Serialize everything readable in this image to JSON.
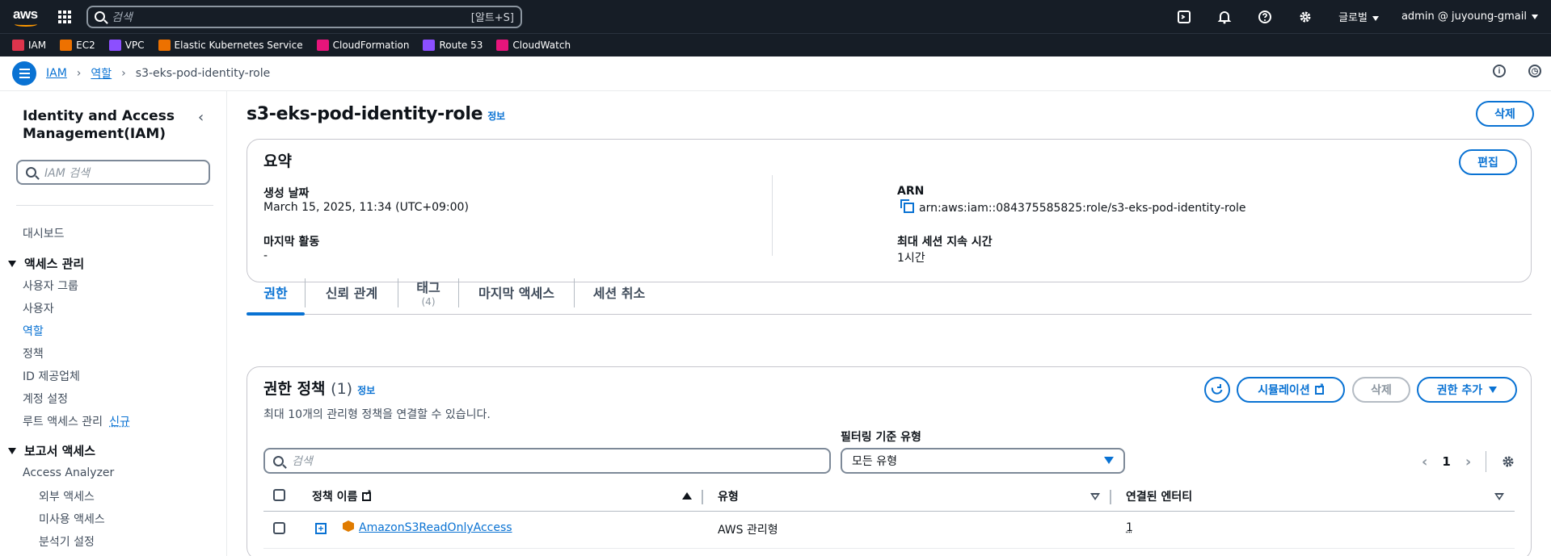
{
  "topnav": {
    "search_placeholder": "검색",
    "search_shortcut": "[알트+S]",
    "region": "글로벌",
    "account": "admin @ juyoung-gmail"
  },
  "favorites": [
    {
      "label": "IAM",
      "color": "#dd344c"
    },
    {
      "label": "EC2",
      "color": "#ed7100"
    },
    {
      "label": "VPC",
      "color": "#8c4fff"
    },
    {
      "label": "Elastic Kubernetes Service",
      "color": "#ed7100"
    },
    {
      "label": "CloudFormation",
      "color": "#e7157b"
    },
    {
      "label": "Route 53",
      "color": "#8c4fff"
    },
    {
      "label": "CloudWatch",
      "color": "#e7157b"
    }
  ],
  "breadcrumb": {
    "root": "IAM",
    "mid": "역할",
    "current": "s3-eks-pod-identity-role"
  },
  "sidebar": {
    "title": "Identity and Access Management(IAM)",
    "search_placeholder": "IAM 검색",
    "dashboard": "대시보드",
    "access_mgmt": {
      "title": "액세스 관리",
      "items": [
        "사용자 그룹",
        "사용자",
        "역할",
        "정책",
        "ID 제공업체",
        "계정 설정",
        "루트 액세스 관리"
      ],
      "new_badge": "신규"
    },
    "reports": {
      "title": "보고서 액세스",
      "analyzer": "Access Analyzer",
      "items": [
        "외부 액세스",
        "미사용 액세스",
        "분석기 설정"
      ]
    }
  },
  "page": {
    "title": "s3-eks-pod-identity-role",
    "info": "정보",
    "delete_label": "삭제"
  },
  "summary": {
    "title": "요약",
    "edit_label": "편집",
    "created_label": "생성 날짜",
    "created_value": "March 15, 2025, 11:34 (UTC+09:00)",
    "last_activity_label": "마지막 활동",
    "last_activity_value": "-",
    "arn_label": "ARN",
    "arn_value": "arn:aws:iam::084375585825:role/s3-eks-pod-identity-role",
    "max_session_label": "최대 세션 지속 시간",
    "max_session_value": "1시간"
  },
  "tabs": [
    {
      "label": "권한",
      "count": ""
    },
    {
      "label": "신뢰 관계",
      "count": ""
    },
    {
      "label": "태그",
      "count": "(4)"
    },
    {
      "label": "마지막 액세스",
      "count": ""
    },
    {
      "label": "세션 취소",
      "count": ""
    }
  ],
  "permissions": {
    "title": "권한 정책",
    "count": "(1)",
    "info": "정보",
    "subtitle": "최대 10개의 관리형 정책을 연결할 수 있습니다.",
    "simulate_label": "시뮬레이션",
    "delete_label": "삭제",
    "add_label": "권한 추가",
    "filter_label": "필터링 기준 유형",
    "search_placeholder": "검색",
    "filter_value": "모든 유형",
    "page": "1",
    "columns": {
      "name": "정책 이름",
      "type": "유형",
      "entities": "연결된 엔터티"
    },
    "rows": [
      {
        "name": "AmazonS3ReadOnlyAccess",
        "type": "AWS 관리형",
        "entities": "1"
      }
    ]
  }
}
